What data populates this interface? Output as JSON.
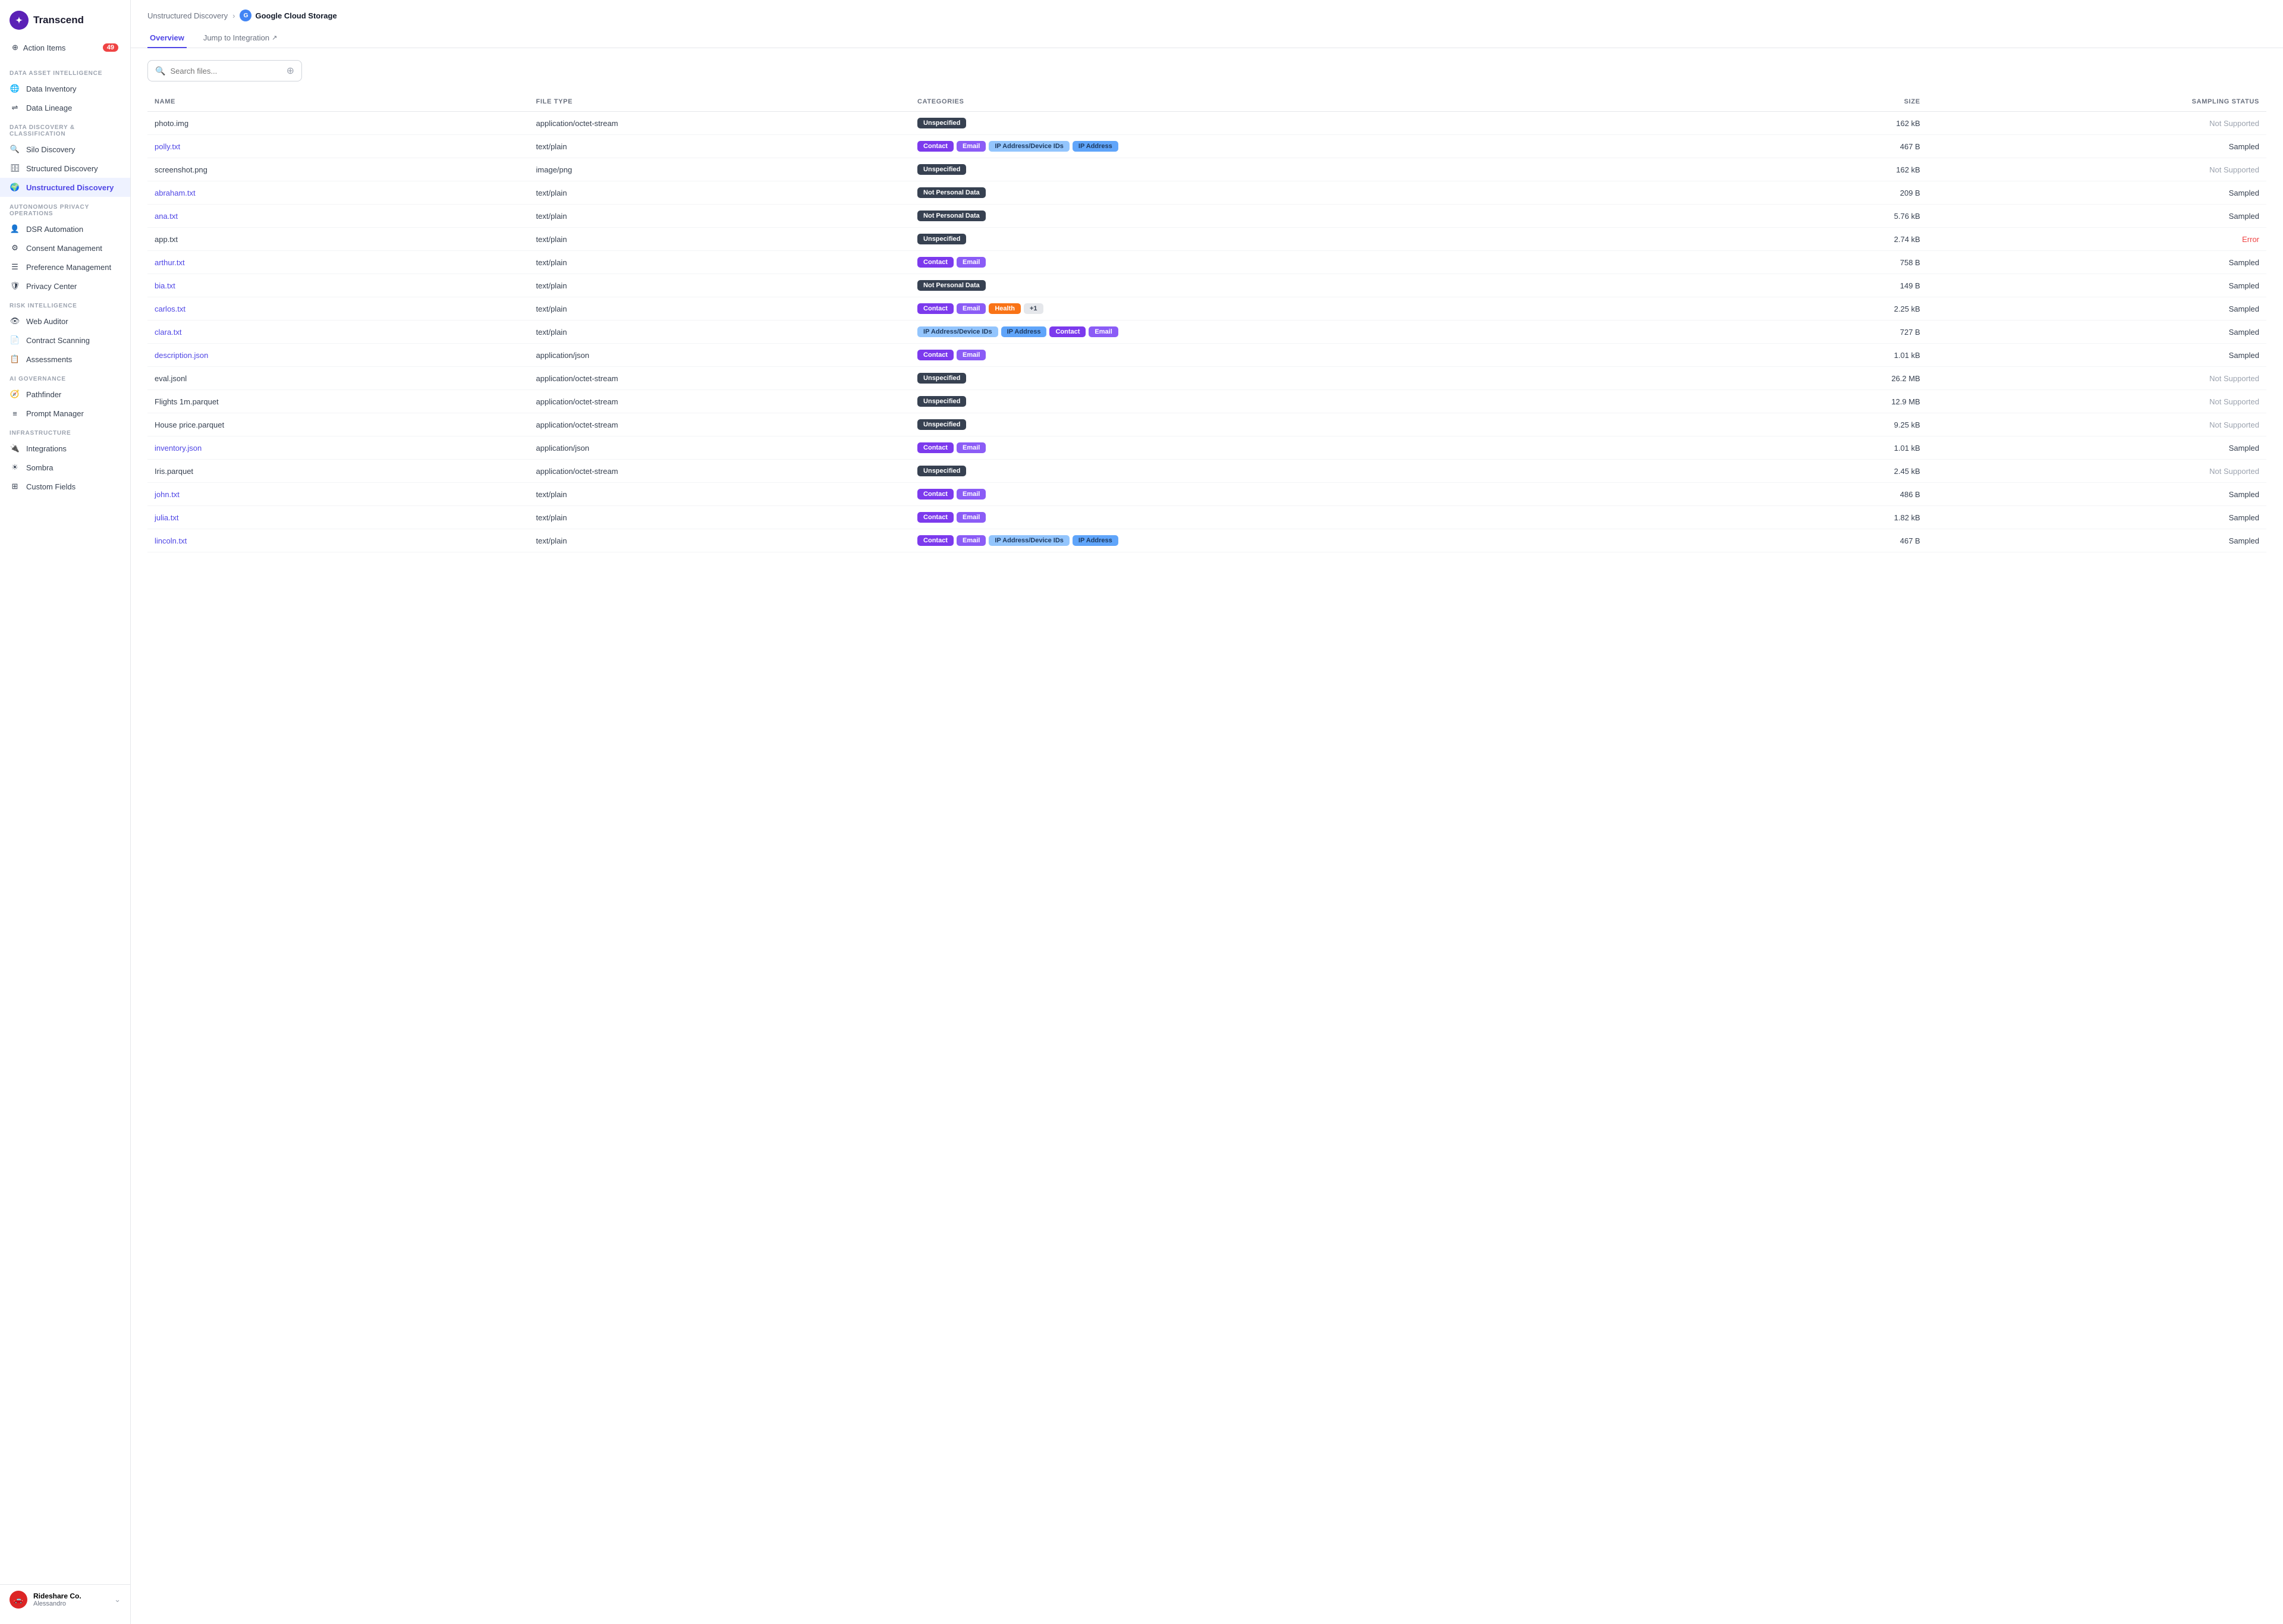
{
  "app": {
    "name": "Transcend"
  },
  "sidebar": {
    "action_items_label": "Action Items",
    "action_items_count": "49",
    "sections": [
      {
        "title": "Data Asset Intelligence",
        "items": [
          {
            "id": "data-inventory",
            "label": "Data Inventory",
            "icon": "globe"
          },
          {
            "id": "data-lineage",
            "label": "Data Lineage",
            "icon": "share"
          }
        ]
      },
      {
        "title": "Data Discovery & Classification",
        "items": [
          {
            "id": "silo-discovery",
            "label": "Silo Discovery",
            "icon": "search"
          },
          {
            "id": "structured-discovery",
            "label": "Structured Discovery",
            "icon": "database"
          },
          {
            "id": "unstructured-discovery",
            "label": "Unstructured Discovery",
            "icon": "globe-alt",
            "active": true
          }
        ]
      },
      {
        "title": "Autonomous Privacy Operations",
        "items": [
          {
            "id": "dsr-automation",
            "label": "DSR Automation",
            "icon": "user-cog"
          },
          {
            "id": "consent-management",
            "label": "Consent Management",
            "icon": "toggle"
          },
          {
            "id": "preference-management",
            "label": "Preference Management",
            "icon": "sliders"
          },
          {
            "id": "privacy-center",
            "label": "Privacy Center",
            "icon": "shield"
          }
        ]
      },
      {
        "title": "Risk Intelligence",
        "items": [
          {
            "id": "web-auditor",
            "label": "Web Auditor",
            "icon": "eye"
          },
          {
            "id": "contract-scanning",
            "label": "Contract Scanning",
            "icon": "doc"
          },
          {
            "id": "assessments",
            "label": "Assessments",
            "icon": "clipboard"
          }
        ]
      },
      {
        "title": "AI Governance",
        "items": [
          {
            "id": "pathfinder",
            "label": "Pathfinder",
            "icon": "compass"
          },
          {
            "id": "prompt-manager",
            "label": "Prompt Manager",
            "icon": "list"
          }
        ]
      },
      {
        "title": "Infrastructure",
        "items": [
          {
            "id": "integrations",
            "label": "Integrations",
            "icon": "puzzle"
          },
          {
            "id": "sombra",
            "label": "Sombra",
            "icon": "sun"
          },
          {
            "id": "custom-fields",
            "label": "Custom Fields",
            "icon": "grid"
          }
        ]
      }
    ],
    "footer": {
      "company": "Rideshare Co.",
      "user": "Alessandro"
    }
  },
  "breadcrumb": {
    "parent": "Unstructured Discovery",
    "current": "Google Cloud Storage"
  },
  "tabs": [
    {
      "id": "overview",
      "label": "Overview",
      "active": true
    },
    {
      "id": "jump-integration",
      "label": "Jump to Integration",
      "external": true
    }
  ],
  "search": {
    "placeholder": "Search files..."
  },
  "table": {
    "columns": [
      "NAME",
      "FILE TYPE",
      "CATEGORIES",
      "SIZE",
      "SAMPLING STATUS"
    ],
    "rows": [
      {
        "name": "photo.img",
        "link": false,
        "filetype": "application/octet-stream",
        "categories": [
          {
            "label": "Unspecified",
            "type": "unspecified"
          }
        ],
        "size": "162 kB",
        "status": "Not Supported",
        "status_type": "not-supported"
      },
      {
        "name": "polly.txt",
        "link": true,
        "filetype": "text/plain",
        "categories": [
          {
            "label": "Contact",
            "type": "contact"
          },
          {
            "label": "Email",
            "type": "email"
          },
          {
            "label": "IP Address/Device IDs",
            "type": "ip-device"
          },
          {
            "label": "IP Address",
            "type": "ip"
          }
        ],
        "size": "467 B",
        "status": "Sampled",
        "status_type": "sampled"
      },
      {
        "name": "screenshot.png",
        "link": false,
        "filetype": "image/png",
        "categories": [
          {
            "label": "Unspecified",
            "type": "unspecified"
          }
        ],
        "size": "162 kB",
        "status": "Not Supported",
        "status_type": "not-supported"
      },
      {
        "name": "abraham.txt",
        "link": true,
        "filetype": "text/plain",
        "categories": [
          {
            "label": "Not Personal Data",
            "type": "not-personal"
          }
        ],
        "size": "209 B",
        "status": "Sampled",
        "status_type": "sampled"
      },
      {
        "name": "ana.txt",
        "link": true,
        "filetype": "text/plain",
        "categories": [
          {
            "label": "Not Personal Data",
            "type": "not-personal"
          }
        ],
        "size": "5.76 kB",
        "status": "Sampled",
        "status_type": "sampled"
      },
      {
        "name": "app.txt",
        "link": false,
        "filetype": "text/plain",
        "categories": [
          {
            "label": "Unspecified",
            "type": "unspecified"
          }
        ],
        "size": "2.74 kB",
        "status": "Error",
        "status_type": "error"
      },
      {
        "name": "arthur.txt",
        "link": true,
        "filetype": "text/plain",
        "categories": [
          {
            "label": "Contact",
            "type": "contact"
          },
          {
            "label": "Email",
            "type": "email"
          }
        ],
        "size": "758 B",
        "status": "Sampled",
        "status_type": "sampled"
      },
      {
        "name": "bia.txt",
        "link": true,
        "filetype": "text/plain",
        "categories": [
          {
            "label": "Not Personal Data",
            "type": "not-personal"
          }
        ],
        "size": "149 B",
        "status": "Sampled",
        "status_type": "sampled"
      },
      {
        "name": "carlos.txt",
        "link": true,
        "filetype": "text/plain",
        "categories": [
          {
            "label": "Contact",
            "type": "contact"
          },
          {
            "label": "Email",
            "type": "email"
          },
          {
            "label": "Health",
            "type": "health"
          },
          {
            "label": "+1",
            "type": "plus"
          }
        ],
        "size": "2.25 kB",
        "status": "Sampled",
        "status_type": "sampled"
      },
      {
        "name": "clara.txt",
        "link": true,
        "filetype": "text/plain",
        "categories": [
          {
            "label": "IP Address/Device IDs",
            "type": "ip-device"
          },
          {
            "label": "IP Address",
            "type": "ip"
          },
          {
            "label": "Contact",
            "type": "contact"
          },
          {
            "label": "Email",
            "type": "email"
          }
        ],
        "size": "727 B",
        "status": "Sampled",
        "status_type": "sampled"
      },
      {
        "name": "description.json",
        "link": true,
        "filetype": "application/json",
        "categories": [
          {
            "label": "Contact",
            "type": "contact"
          },
          {
            "label": "Email",
            "type": "email"
          }
        ],
        "size": "1.01 kB",
        "status": "Sampled",
        "status_type": "sampled"
      },
      {
        "name": "eval.jsonl",
        "link": false,
        "filetype": "application/octet-stream",
        "categories": [
          {
            "label": "Unspecified",
            "type": "unspecified"
          }
        ],
        "size": "26.2 MB",
        "status": "Not Supported",
        "status_type": "not-supported"
      },
      {
        "name": "Flights 1m.parquet",
        "link": false,
        "filetype": "application/octet-stream",
        "categories": [
          {
            "label": "Unspecified",
            "type": "unspecified"
          }
        ],
        "size": "12.9 MB",
        "status": "Not Supported",
        "status_type": "not-supported"
      },
      {
        "name": "House price.parquet",
        "link": false,
        "filetype": "application/octet-stream",
        "categories": [
          {
            "label": "Unspecified",
            "type": "unspecified"
          }
        ],
        "size": "9.25 kB",
        "status": "Not Supported",
        "status_type": "not-supported"
      },
      {
        "name": "inventory.json",
        "link": true,
        "filetype": "application/json",
        "categories": [
          {
            "label": "Contact",
            "type": "contact"
          },
          {
            "label": "Email",
            "type": "email"
          }
        ],
        "size": "1.01 kB",
        "status": "Sampled",
        "status_type": "sampled"
      },
      {
        "name": "Iris.parquet",
        "link": false,
        "filetype": "application/octet-stream",
        "categories": [
          {
            "label": "Unspecified",
            "type": "unspecified"
          }
        ],
        "size": "2.45 kB",
        "status": "Not Supported",
        "status_type": "not-supported"
      },
      {
        "name": "john.txt",
        "link": true,
        "filetype": "text/plain",
        "categories": [
          {
            "label": "Contact",
            "type": "contact"
          },
          {
            "label": "Email",
            "type": "email"
          }
        ],
        "size": "486 B",
        "status": "Sampled",
        "status_type": "sampled"
      },
      {
        "name": "julia.txt",
        "link": true,
        "filetype": "text/plain",
        "categories": [
          {
            "label": "Contact",
            "type": "contact"
          },
          {
            "label": "Email",
            "type": "email"
          }
        ],
        "size": "1.82 kB",
        "status": "Sampled",
        "status_type": "sampled"
      },
      {
        "name": "lincoln.txt",
        "link": true,
        "filetype": "text/plain",
        "categories": [
          {
            "label": "Contact",
            "type": "contact"
          },
          {
            "label": "Email",
            "type": "email"
          },
          {
            "label": "IP Address/Device IDs",
            "type": "ip-device"
          },
          {
            "label": "IP Address",
            "type": "ip"
          }
        ],
        "size": "467 B",
        "status": "Sampled",
        "status_type": "sampled"
      }
    ]
  }
}
